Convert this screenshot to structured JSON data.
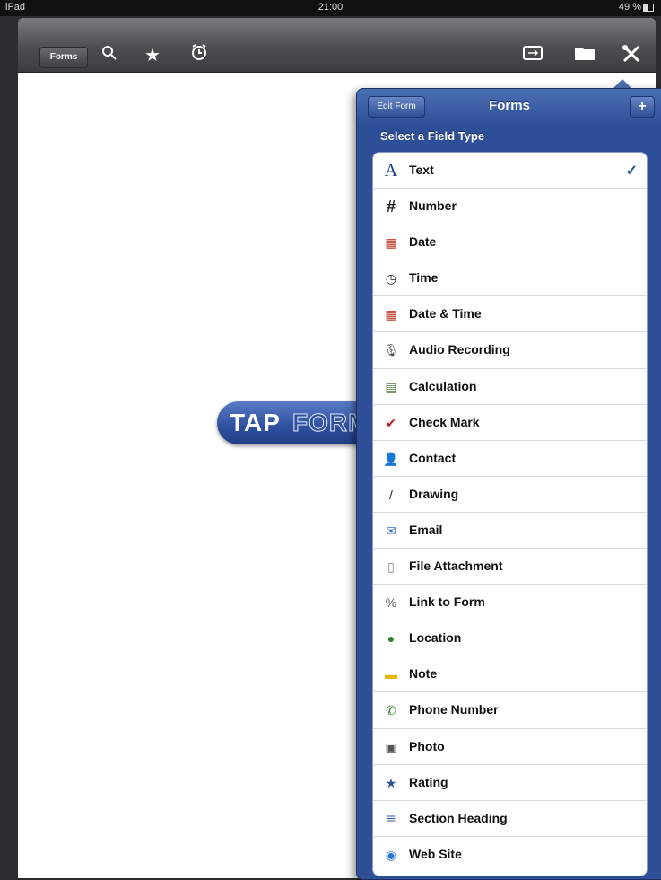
{
  "status": {
    "left": "iPad",
    "time": "21:00",
    "battery": "49 %"
  },
  "toolbar": {
    "forms_label": "Forms",
    "icons": [
      "search-icon",
      "star-icon",
      "alarm-icon",
      "sync-icon",
      "folder-icon",
      "tools-icon"
    ]
  },
  "logo": {
    "tap": "TAP",
    "forms": "FORMS"
  },
  "popover": {
    "edit_label": "Edit Form",
    "title": "Forms",
    "plus_label": "+",
    "subtitle": "Select a Field Type",
    "selected": "Text",
    "items": [
      {
        "label": "Text",
        "icon": "A",
        "color": "#1f3a8a"
      },
      {
        "label": "Number",
        "icon": "#",
        "color": "#222"
      },
      {
        "label": "Date",
        "icon": "▦",
        "color": "#c0392b"
      },
      {
        "label": "Time",
        "icon": "◷",
        "color": "#222"
      },
      {
        "label": "Date & Time",
        "icon": "▦",
        "color": "#c0392b"
      },
      {
        "label": "Audio Recording",
        "icon": "🎙",
        "color": "#555"
      },
      {
        "label": "Calculation",
        "icon": "▤",
        "color": "#4a7a3a"
      },
      {
        "label": "Check Mark",
        "icon": "✔",
        "color": "#b71c1c"
      },
      {
        "label": "Contact",
        "icon": "👤",
        "color": "#222"
      },
      {
        "label": "Drawing",
        "icon": "/",
        "color": "#222"
      },
      {
        "label": "Email",
        "icon": "✉",
        "color": "#3b6fd1"
      },
      {
        "label": "File Attachment",
        "icon": "▯",
        "color": "#888"
      },
      {
        "label": "Link to Form",
        "icon": "%",
        "color": "#555"
      },
      {
        "label": "Location",
        "icon": "●",
        "color": "#2e7d32"
      },
      {
        "label": "Note",
        "icon": "▬",
        "color": "#e6b800"
      },
      {
        "label": "Phone Number",
        "icon": "✆",
        "color": "#2e7d32"
      },
      {
        "label": "Photo",
        "icon": "▣",
        "color": "#555"
      },
      {
        "label": "Rating",
        "icon": "★",
        "color": "#2d4f98"
      },
      {
        "label": "Section Heading",
        "icon": "≣",
        "color": "#2d4f98"
      },
      {
        "label": "Web Site",
        "icon": "◉",
        "color": "#2a78d6"
      }
    ]
  }
}
